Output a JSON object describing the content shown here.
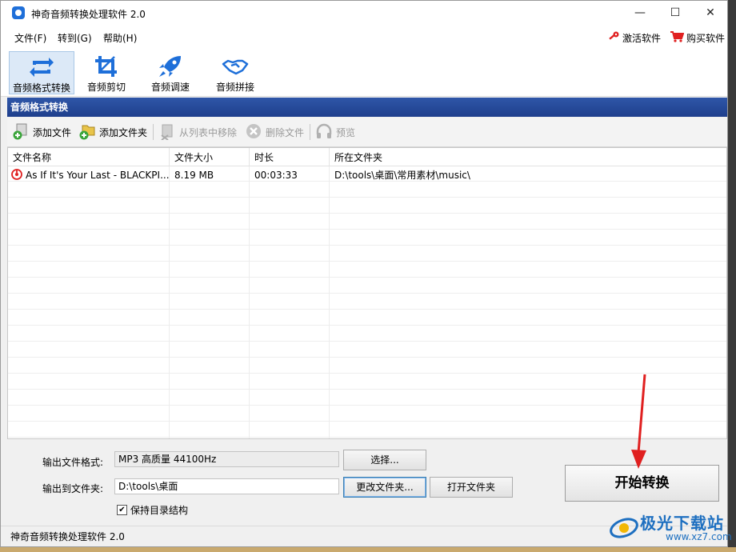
{
  "window": {
    "title": "神奇音频转换处理软件 2.0"
  },
  "titlebar_buttons": {
    "minimize": "—",
    "maximize": "☐",
    "close": "✕"
  },
  "menu": [
    {
      "label": "文件(F)"
    },
    {
      "label": "转到(G)"
    },
    {
      "label": "帮助(H)"
    }
  ],
  "right_links": {
    "activate": "激活软件",
    "buy": "购买软件"
  },
  "toolbar": [
    {
      "label": "音频格式转换",
      "icon": "convert-arrows-icon",
      "active": true
    },
    {
      "label": "音频剪切",
      "icon": "crop-icon",
      "active": false
    },
    {
      "label": "音频调速",
      "icon": "rocket-icon",
      "active": false
    },
    {
      "label": "音频拼接",
      "icon": "handshake-icon",
      "active": false
    }
  ],
  "section_title": "音频格式转换",
  "subtoolbar": {
    "add_file": "添加文件",
    "add_folder": "添加文件夹",
    "remove": "从列表中移除",
    "delete": "删除文件",
    "preview": "预览"
  },
  "table": {
    "columns": [
      "文件名称",
      "文件大小",
      "时长",
      "所在文件夹"
    ],
    "rows": [
      {
        "name": "As If It's Your Last - BLACKPI...",
        "size": "8.19 MB",
        "duration": "00:03:33",
        "folder": "D:\\tools\\桌面\\常用素材\\music\\"
      }
    ]
  },
  "output": {
    "format_label": "输出文件格式:",
    "format_value": "MP3 高质量 44100Hz",
    "select_button": "选择...",
    "folder_label": "输出到文件夹:",
    "folder_value": "D:\\tools\\桌面",
    "change_folder_button": "更改文件夹...",
    "open_folder_button": "打开文件夹",
    "keep_structure": "保持目录结构",
    "keep_structure_checked": true,
    "start_button": "开始转换"
  },
  "statusbar": {
    "text": "神奇音频转换处理软件 2.0"
  },
  "watermark": {
    "text": "极光下载站",
    "url": "www.xz7.com"
  },
  "colors": {
    "section_header": "#2f56a8",
    "toolbar_active": "#dce9f7",
    "icon_blue": "#1e6fd9",
    "arrow_red": "#e02020"
  }
}
